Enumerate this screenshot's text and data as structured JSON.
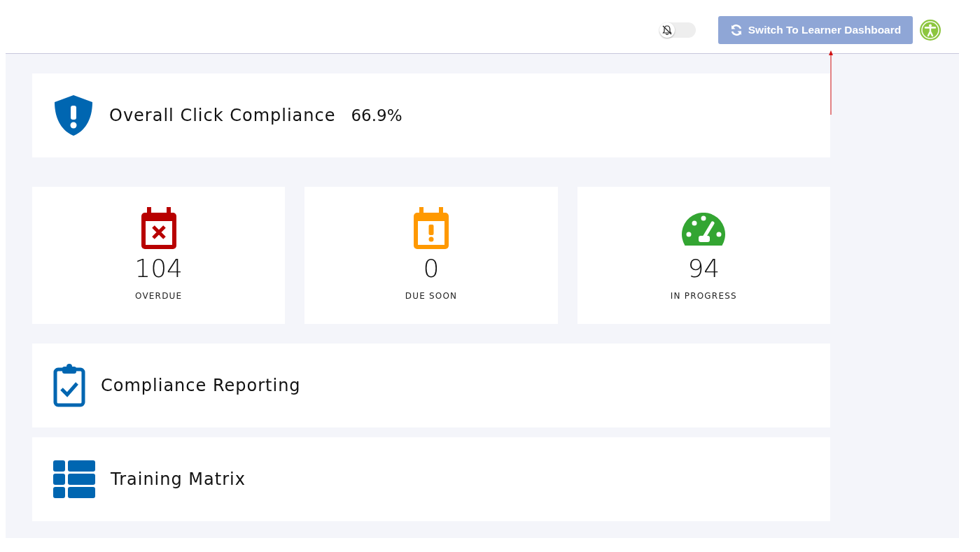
{
  "header": {
    "notifications_toggle": {
      "on": false
    },
    "switch_button": {
      "label": "Switch To Learner Dashboard"
    }
  },
  "compliance": {
    "title": "Overall Click Compliance",
    "value": "66.9%"
  },
  "stats": [
    {
      "kind": "overdue",
      "value": "104",
      "label": "OVERDUE",
      "color": "#b80000"
    },
    {
      "kind": "due_soon",
      "value": "0",
      "label": "DUE SOON",
      "color": "#ff9900"
    },
    {
      "kind": "in_progress",
      "value": "94",
      "label": "IN PROGRESS",
      "color": "#33a532"
    }
  ],
  "sections": [
    {
      "kind": "reporting",
      "title": "Compliance Reporting"
    },
    {
      "kind": "matrix",
      "title": "Training Matrix"
    }
  ]
}
